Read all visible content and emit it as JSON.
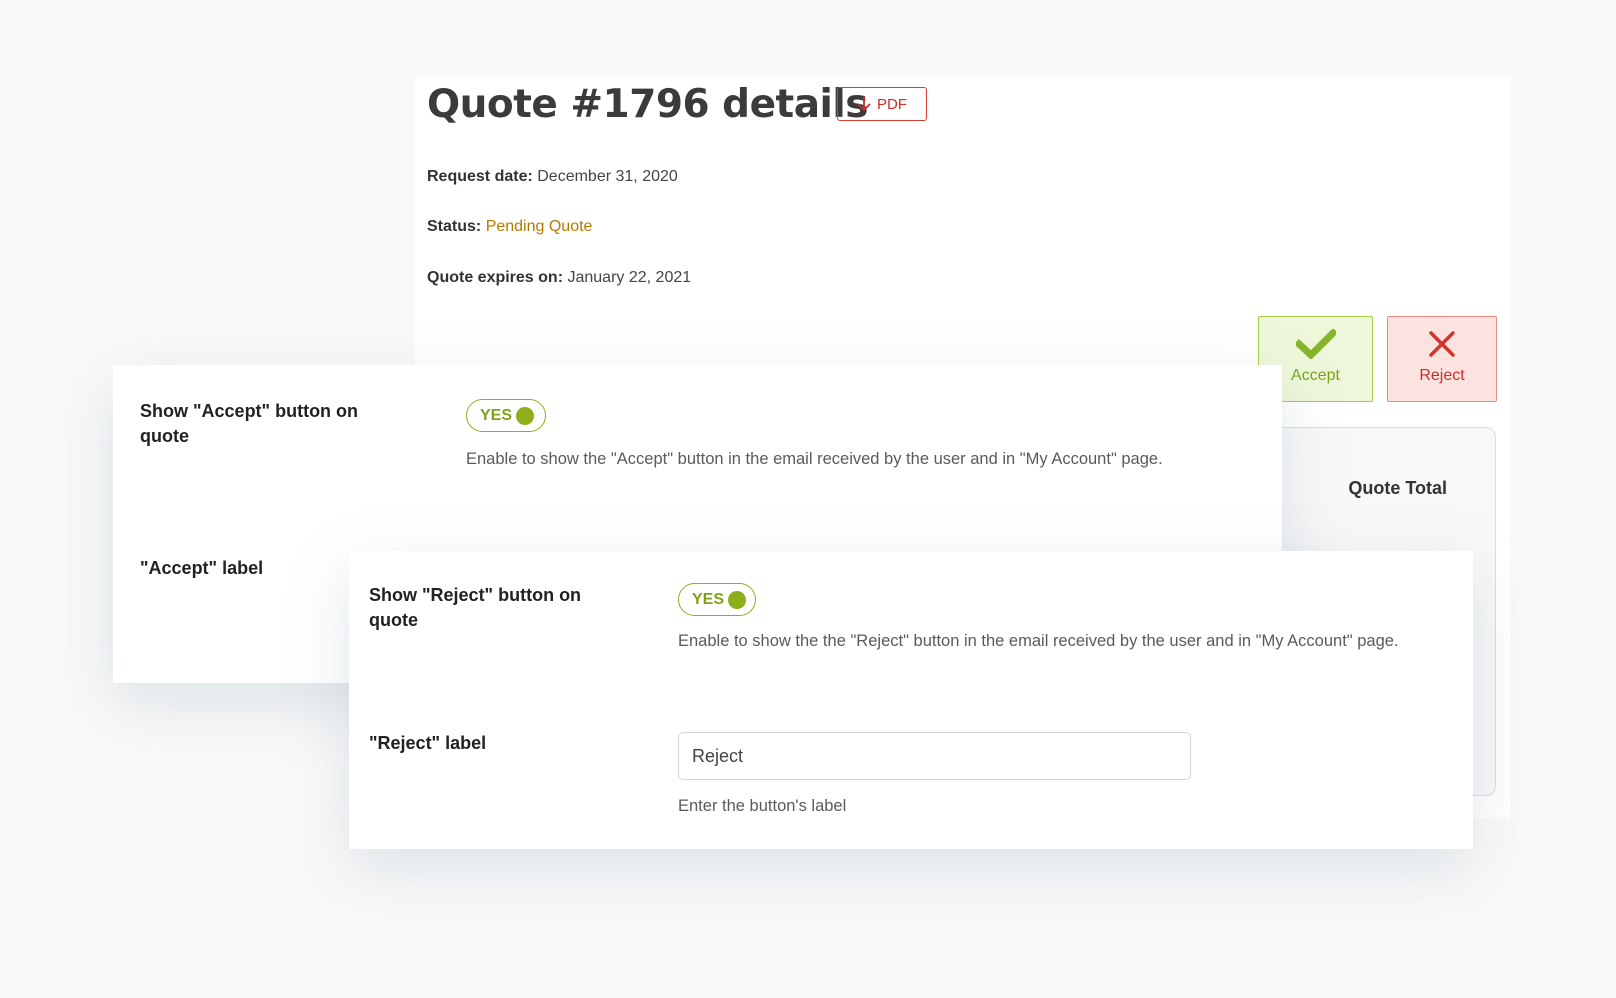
{
  "quote": {
    "title": "Quote #1796 details",
    "pdf_label": "PDF",
    "request_date_label": "Request date:",
    "request_date_value": "December 31, 2020",
    "status_label": "Status:",
    "status_value": "Pending Quote",
    "expires_label": "Quote expires on:",
    "expires_value": "January 22, 2021",
    "accept_label": "Accept",
    "reject_label": "Reject",
    "totals_label": "Quote Total"
  },
  "accept_settings": {
    "show_label": "Show \"Accept\" button on quote",
    "toggle_text": "YES",
    "description": "Enable to show the \"Accept\" button in the email received by the user and in \"My Account\" page.",
    "label_field": "\"Accept\" label"
  },
  "reject_settings": {
    "show_label": "Show \"Reject\" button on quote",
    "toggle_text": "YES",
    "description": "Enable to show the the \"Reject\" button in the email received by the user and in \"My Account\" page.",
    "label_field": "\"Reject\" label",
    "input_value": "Reject",
    "input_help": "Enter the button's label"
  },
  "colors": {
    "background": "#f9f9f9",
    "status_pending": "#b57900",
    "accept_green": "#77a31a",
    "reject_red": "#c9302c",
    "toggle_green": "#8fae1b"
  },
  "icons": [
    "arrow-down-icon",
    "checkmark-icon",
    "close-x-icon",
    "toggle-knob"
  ]
}
